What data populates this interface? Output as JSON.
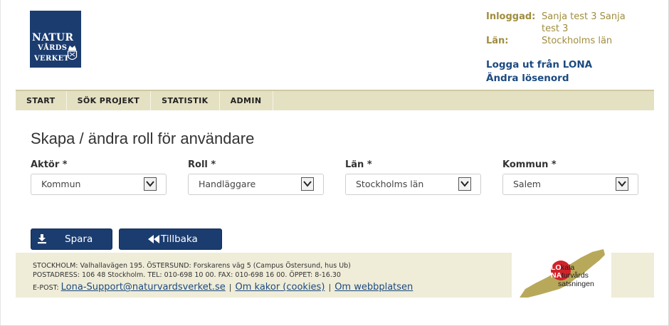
{
  "logo": {
    "line1": "NATUR",
    "line2": "VÅRDS",
    "line3": "VERKET"
  },
  "user": {
    "logged_in_label": "Inloggad:",
    "logged_in_value": "Sanja test 3 Sanja test 3",
    "county_label": "Län:",
    "county_value": "Stockholms län",
    "logout_link": "Logga ut från LONA",
    "change_password_link": "Ändra lösenord"
  },
  "nav": {
    "items": [
      "START",
      "SÖK PROJEKT",
      "STATISTIK",
      "ADMIN"
    ]
  },
  "page_title": "Skapa / ändra roll för användare",
  "fields": [
    {
      "label": "Aktör *",
      "value": "Kommun"
    },
    {
      "label": "Roll *",
      "value": "Handläggare"
    },
    {
      "label": "Län *",
      "value": "Stockholms län"
    },
    {
      "label": "Kommun *",
      "value": "Salem"
    }
  ],
  "buttons": {
    "save": "Spara",
    "back": "Tillbaka"
  },
  "footer": {
    "line1": "STOCKHOLM: Valhallavägen 195. ÖSTERSUND: Forskarens väg 5 (Campus Östersund, hus Ub)",
    "line2": "POSTADRESS: 106 48 Stockholm. TEL: 010-698 10 00. FAX: 010-698 16 00. ÖPPET: 8-16.30",
    "email_label": "E-POST:",
    "email_link": "Lona-Support@naturvardsverket.se",
    "cookies_link": "Om kakor (cookies)",
    "website_link": "Om webbplatsen",
    "separator": "|"
  },
  "lona_logo": {
    "lo": "LO",
    "kala": "kala",
    "na": "NA",
    "turvards": "turvårds",
    "satsningen": "satsningen"
  },
  "colors": {
    "brand_blue": "#1b3c6f",
    "gold_text": "#a08d3e",
    "nav_bg": "#e4e0c2",
    "footer_bg": "#efecd8",
    "lona_red": "#d2232a",
    "lona_gold": "#b8a95a"
  }
}
